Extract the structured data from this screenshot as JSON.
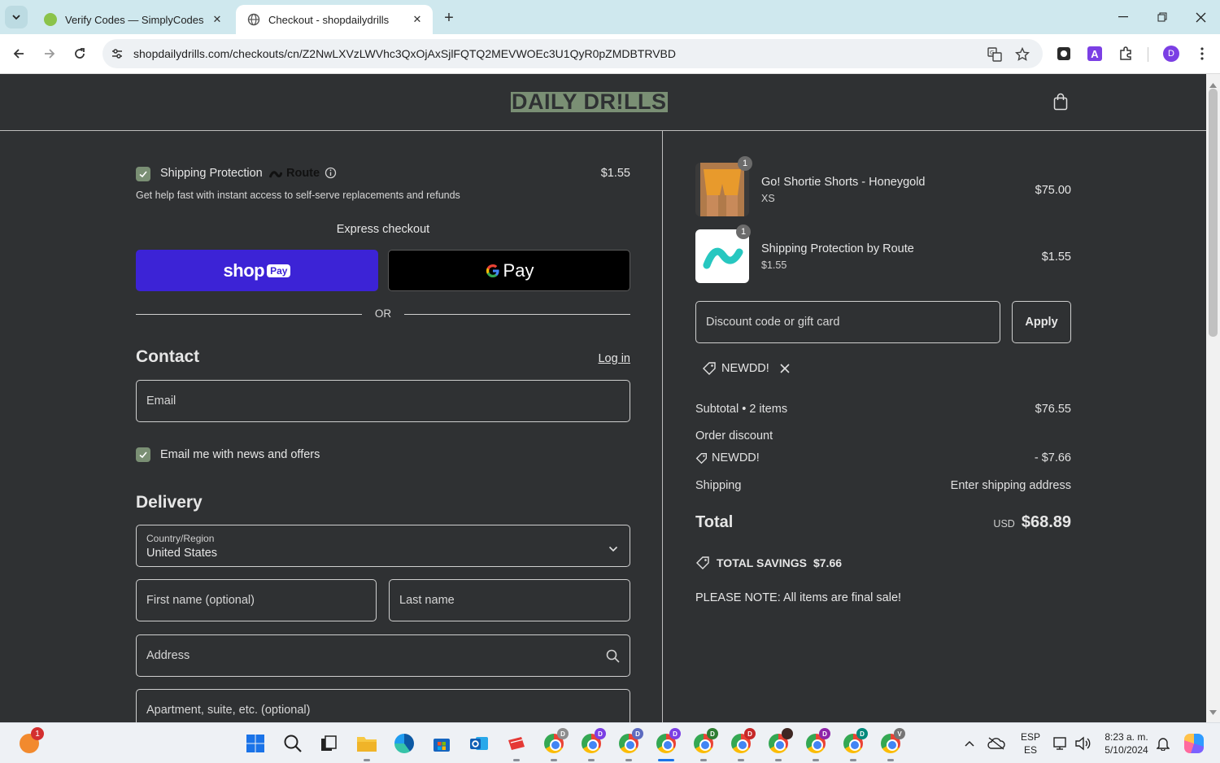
{
  "browser": {
    "tabs": [
      {
        "title": "Verify Codes — SimplyCodes",
        "active": false
      },
      {
        "title": "Checkout - shopdailydrills",
        "active": true
      }
    ],
    "url": "shopdailydrills.com/checkouts/cn/Z2NwLXVzLWVhc3QxOjAxSjlFQTQ2MEVWOEc3U1QyR0pZMDBTRVBD",
    "profile_initial": "D",
    "extension_letter": "A"
  },
  "header": {
    "logo": "DAILY DR!LLS"
  },
  "shipping_protection": {
    "label": "Shipping Protection",
    "brand": "Route",
    "price": "$1.55",
    "description": "Get help fast with instant access to self-serve replacements and refunds",
    "checked": true
  },
  "express": {
    "heading": "Express checkout",
    "shop_label": "shop",
    "shop_pay_badge": "Pay",
    "gpay_label": "Pay",
    "or_label": "OR"
  },
  "contact": {
    "heading": "Contact",
    "login_link": "Log in",
    "email_placeholder": "Email",
    "newsletter_label": "Email me with news and offers"
  },
  "delivery": {
    "heading": "Delivery",
    "country_label": "Country/Region",
    "country_value": "United States",
    "first_name_placeholder": "First name (optional)",
    "last_name_placeholder": "Last name",
    "address_placeholder": "Address",
    "apartment_placeholder": "Apartment, suite, etc. (optional)"
  },
  "order": {
    "items": [
      {
        "name": "Go! Shortie Shorts - Honeygold",
        "variant": "XS",
        "price": "$75.00",
        "qty": "1"
      },
      {
        "name": "Shipping Protection by Route",
        "variant": "$1.55",
        "price": "$1.55",
        "qty": "1"
      }
    ],
    "discount_placeholder": "Discount code or gift card",
    "apply_label": "Apply",
    "applied_code": "NEWDD!",
    "subtotal_label": "Subtotal • 2 items",
    "subtotal_value": "$76.55",
    "order_discount_label": "Order discount",
    "discount_code": "NEWDD!",
    "discount_value": "- $7.66",
    "shipping_label": "Shipping",
    "shipping_value": "Enter shipping address",
    "total_label": "Total",
    "total_currency": "USD",
    "total_value": "$68.89",
    "savings_label": "TOTAL SAVINGS",
    "savings_value": "$7.66",
    "note": "PLEASE NOTE: All items are final sale!"
  },
  "taskbar": {
    "notification_count": "1",
    "language": "ESP",
    "language_sub": "ES",
    "time": "8:23 a. m.",
    "date": "5/10/2024",
    "chrome_profiles": [
      "D",
      "D",
      "D",
      "D",
      "D",
      "D",
      "",
      "D",
      "D",
      "V"
    ]
  },
  "colors": {
    "page_bg": "#2f3133",
    "accent_green": "#7a8f74",
    "shop_pay": "#3c23d6",
    "tab_strip": "#cfe8ee"
  }
}
